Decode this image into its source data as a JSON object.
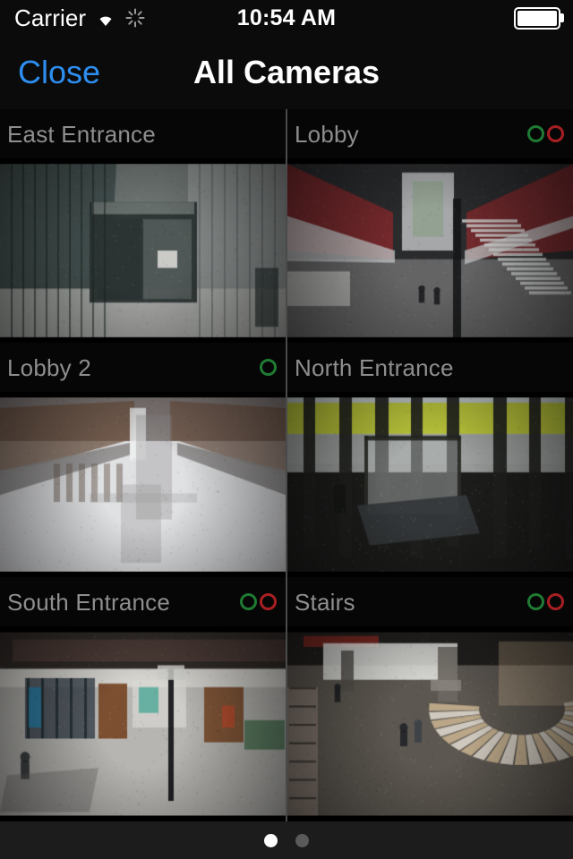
{
  "status_bar": {
    "carrier": "Carrier",
    "wifi_icon": "wifi-icon",
    "activity_icon": "spinner-icon",
    "time": "10:54 AM",
    "battery_icon": "battery-full-icon",
    "battery_level": 100
  },
  "nav_bar": {
    "close_label": "Close",
    "title": "All Cameras",
    "close_color": "#2d8ef0",
    "title_color": "#ffffff"
  },
  "colors": {
    "background": "#000000",
    "label_text": "#8e8e8e",
    "indicator_green": "#1f7a33",
    "indicator_red": "#a81f23",
    "footer_background": "#1c1c1c",
    "divider": "#4a4a4a"
  },
  "cameras": [
    {
      "name": "East Entrance",
      "indicators": [],
      "scene": "glass-entrance-vestibule",
      "palette": [
        "#43504f",
        "#6d7472",
        "#8d9290",
        "#2b3433",
        "#a9aaa6"
      ]
    },
    {
      "name": "Lobby",
      "indicators": [
        "green",
        "red"
      ],
      "scene": "atrium-lobby-with-stairs",
      "palette": [
        "#2a2b2d",
        "#6f6f70",
        "#8e2a2c",
        "#b9babb",
        "#151617"
      ]
    },
    {
      "name": "Lobby 2",
      "indicators": [
        "green"
      ],
      "scene": "bright-atrium-corridor",
      "palette": [
        "#c6c7c9",
        "#8f8d8c",
        "#4a3b35",
        "#6d4b36",
        "#e2e3e5"
      ]
    },
    {
      "name": "North Entrance",
      "indicators": [],
      "scene": "glass-doors-with-lawn",
      "palette": [
        "#b8c433",
        "#2d2f2c",
        "#5e6360",
        "#1a1b19",
        "#8b8f8c"
      ]
    },
    {
      "name": "South Entrance",
      "indicators": [
        "green",
        "red"
      ],
      "scene": "interior-entrance-hall",
      "palette": [
        "#b6b5b1",
        "#7a4a2a",
        "#2f3a44",
        "#2a7fa8",
        "#d8d7d3"
      ]
    },
    {
      "name": "Stairs",
      "indicators": [
        "green",
        "red"
      ],
      "scene": "spiral-staircase-hall",
      "palette": [
        "#5c5751",
        "#cbb592",
        "#a8968a",
        "#2c2a28",
        "#e3dcd1"
      ]
    }
  ],
  "pagination": {
    "total_pages": 2,
    "current_page": 1
  }
}
